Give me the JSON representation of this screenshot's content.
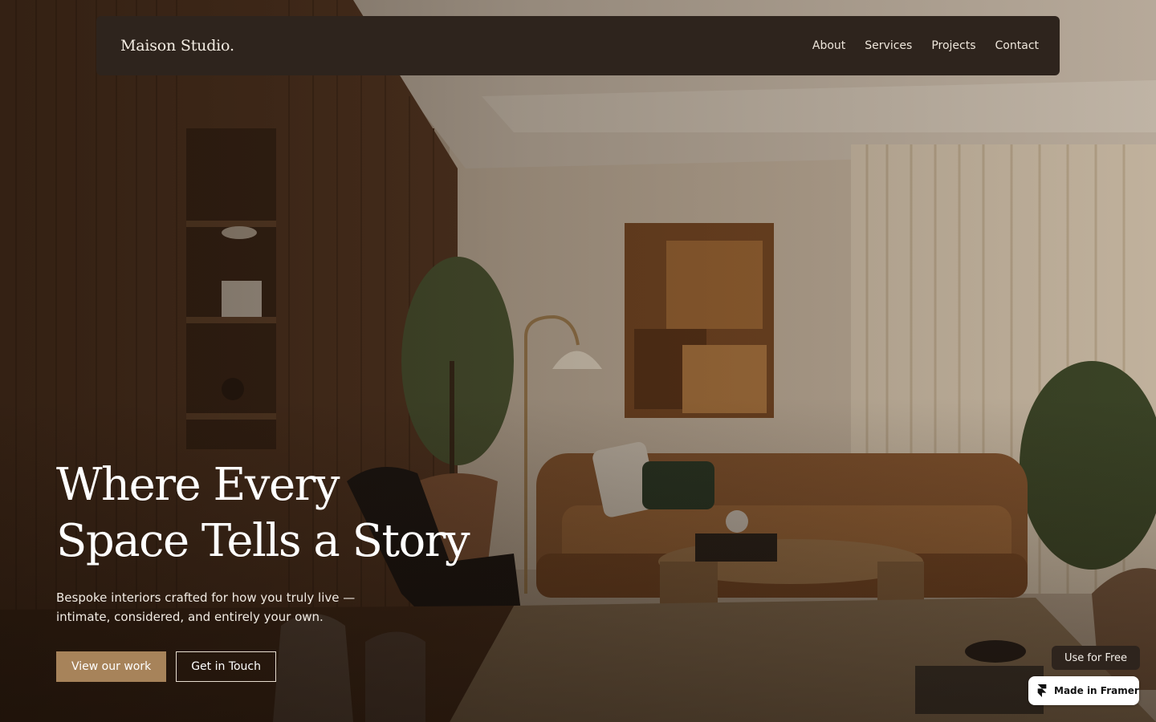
{
  "brand": {
    "logo": "Maison Studio."
  },
  "nav": {
    "links": [
      "About",
      "Services",
      "Projects",
      "Contact"
    ]
  },
  "hero": {
    "headline_line1": "Where Every",
    "headline_line2": "Space Tells a Story",
    "subtitle_line1": "Bespoke interiors crafted for how you truly live —",
    "subtitle_line2": "intimate, considered, and entirely your own.",
    "primary_cta": "View our work",
    "secondary_cta": "Get in Touch"
  },
  "badges": {
    "use_for_free": "Use for Free",
    "made_in_framer": "Made in Framer"
  },
  "colors": {
    "navbar_bg": "#2e241d",
    "primary_button": "#a7835a",
    "text_light": "#ffffff"
  }
}
